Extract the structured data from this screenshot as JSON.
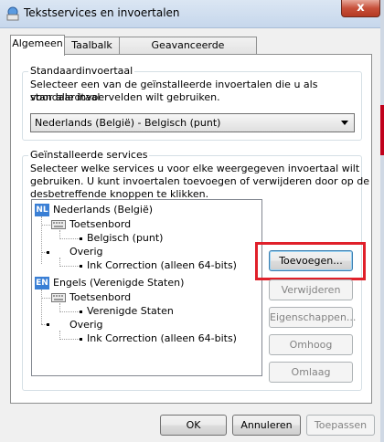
{
  "window": {
    "title": "Tekstservices en invoertalen",
    "close_label": "x",
    "icon": "keyboard-globe-icon"
  },
  "tabs": [
    {
      "label": "Algemeen",
      "active": true
    },
    {
      "label": "Taalbalk",
      "active": false
    },
    {
      "label": "Geavanceerde toetsinstellingen",
      "active": false
    }
  ],
  "default_language": {
    "group_title": "Standaardinvoertaal",
    "description_line1": "Selecteer een van de geïnstalleerde invoertalen die u als standaardtaal",
    "description_line2": "voor alle invoervelden wilt gebruiken.",
    "selected": "Nederlands (België) - Belgisch (punt)"
  },
  "installed_services": {
    "group_title": "Geïnstalleerde services",
    "description_line1": "Selecteer welke services u voor elke weergegeven invoertaal wilt",
    "description_line2": "gebruiken. U kunt invoertalen toevoegen of verwijderen door op de",
    "description_line3": "desbetreffende knoppen te klikken.",
    "tree": {
      "lang1": {
        "badge": "NL",
        "label": "Nederlands (België)"
      },
      "lang1_keyboard": "Toetsenbord",
      "lang1_keyboard_item": "Belgisch (punt)",
      "lang1_other": "Overig",
      "lang1_other_item": "Ink Correction (alleen 64-bits)",
      "lang2": {
        "badge": "EN",
        "label": "Engels (Verenigde Staten)"
      },
      "lang2_keyboard": "Toetsenbord",
      "lang2_keyboard_item": "Verenigde Staten",
      "lang2_other": "Overig",
      "lang2_other_item": "Ink Correction (alleen 64-bits)"
    },
    "buttons": {
      "add": "Toevoegen...",
      "remove": "Verwijderen",
      "properties": "Eigenschappen...",
      "up": "Omhoog",
      "down": "Omlaag"
    },
    "highlight_color": "#e0202a"
  },
  "footer": {
    "ok": "OK",
    "cancel": "Annuleren",
    "apply": "Toepassen"
  }
}
